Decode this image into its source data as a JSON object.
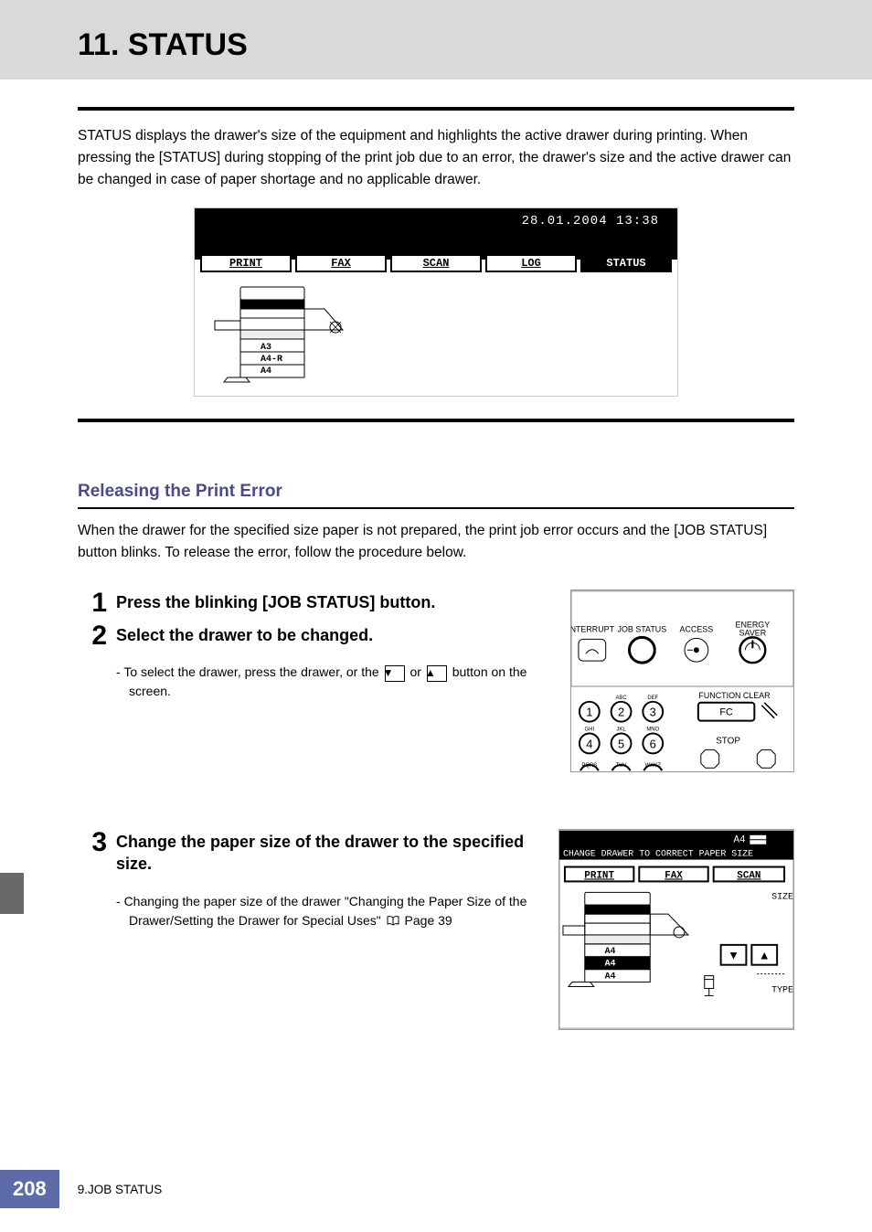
{
  "header": {
    "title": "11. STATUS"
  },
  "intro": "STATUS displays the drawer's size of the equipment and highlights the active drawer during printing. When pressing the [STATUS] during stopping of the print job due to an error, the drawer's size and the active drawer can be changed in case of paper shortage and no applicable drawer.",
  "screenshot1": {
    "timestamp": "28.01.2004 13:38",
    "tabs": [
      {
        "label": "PRINT",
        "active": false
      },
      {
        "label": "FAX",
        "active": false
      },
      {
        "label": "SCAN",
        "active": false
      },
      {
        "label": "LOG",
        "active": false
      },
      {
        "label": "STATUS",
        "active": true
      }
    ],
    "drawers": [
      "A3",
      "A4-R",
      "A4"
    ]
  },
  "section": {
    "title": "Releasing the Print Error",
    "intro": "When the drawer for the specified size paper is not prepared, the print job error occurs and the [JOB STATUS] button blinks. To release the error, follow the procedure below."
  },
  "steps": [
    {
      "num": "1",
      "title": "Press the blinking [JOB STATUS] button."
    },
    {
      "num": "2",
      "title": "Select the drawer to be changed.",
      "detail_pre": "To select the drawer, press the drawer, or the ",
      "detail_post": " button on the screen.",
      "or_text": " or "
    },
    {
      "num": "3",
      "title": "Change the paper size of the drawer to the specified size.",
      "detail_pre": "Changing the paper size of the drawer \"Changing the Paper Size of the Drawer/Setting the Drawer for Special Uses\"  ",
      "page_ref": " Page 39"
    }
  ],
  "control_panel": {
    "labels": {
      "interrupt": "NTERRUPT",
      "job_status": "JOB STATUS",
      "access": "ACCESS",
      "energy_saver": "ENERGY SAVER",
      "function_clear": "FUNCTION CLEAR",
      "fc": "FC",
      "stop": "STOP",
      "key_labels": {
        "abc": "ABC",
        "def": "DEF",
        "ghi": "GHI",
        "jkl": "JKL",
        "mno": "MNO",
        "pqrs": "PQRS",
        "tuv": "TUV",
        "wxyz": "WXYZ"
      }
    }
  },
  "lcd_panel": {
    "top_right": "A4",
    "message": "CHANGE DRAWER TO CORRECT PAPER SIZE",
    "tabs": [
      "PRINT",
      "FAX",
      "SCAN"
    ],
    "size_label": "SIZE",
    "type_label": "TYPE",
    "drawers": [
      "A4",
      "A4",
      "A4"
    ]
  },
  "footer": {
    "page": "208",
    "label": "9.JOB STATUS"
  }
}
